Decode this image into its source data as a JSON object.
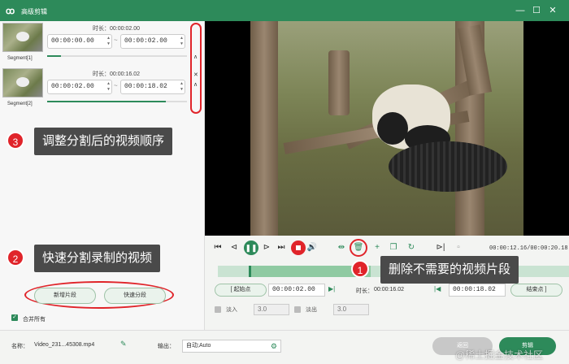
{
  "window": {
    "title": "高级剪辑",
    "logo": "ꝏ"
  },
  "segments": [
    {
      "label": "Segment[1]",
      "duration_label": "时长：00:00:02.00",
      "start": "00:00:00.00",
      "end": "00:00:02.00",
      "progress": 0.1
    },
    {
      "label": "Segment[2]",
      "duration_label": "时长：00:00:16.02",
      "start": "00:00:02.00",
      "end": "00:00:18.02",
      "progress": 0.85
    }
  ],
  "callouts": {
    "c3": {
      "num": "3",
      "text": "调整分割后的视频顺序"
    },
    "c2": {
      "num": "2",
      "text": "快速分割录制的视频"
    },
    "c1": {
      "num": "1",
      "text": "删除不需要的视频片段"
    }
  },
  "buttons": {
    "new_segment": "新增片段",
    "fast_split": "快速分段",
    "merge_all": "合并所有"
  },
  "player": {
    "time_readout": "00:00:12.16/00:00:20.18",
    "start_label": "起始点",
    "start_value": "00:00:02.00",
    "duration_label": "时长：",
    "duration_value": "00:00:16.02",
    "end_value": "00:00:18.02",
    "end_label": "结束点",
    "fade_in_label": "淡入",
    "fade_in_value": "3.0",
    "fade_out_label": "淡出",
    "fade_out_value": "3.0"
  },
  "footer": {
    "name_label": "名称：",
    "file_name": "Video_231...45308.mp4",
    "output_label": "输出：",
    "output_value": "自动;Auto",
    "back_label": "返回",
    "cut_label": "剪辑",
    "watermark": "@稀土掘金技术社区"
  },
  "colors": {
    "accent": "#2d8a5a",
    "highlight": "#e0242a"
  }
}
